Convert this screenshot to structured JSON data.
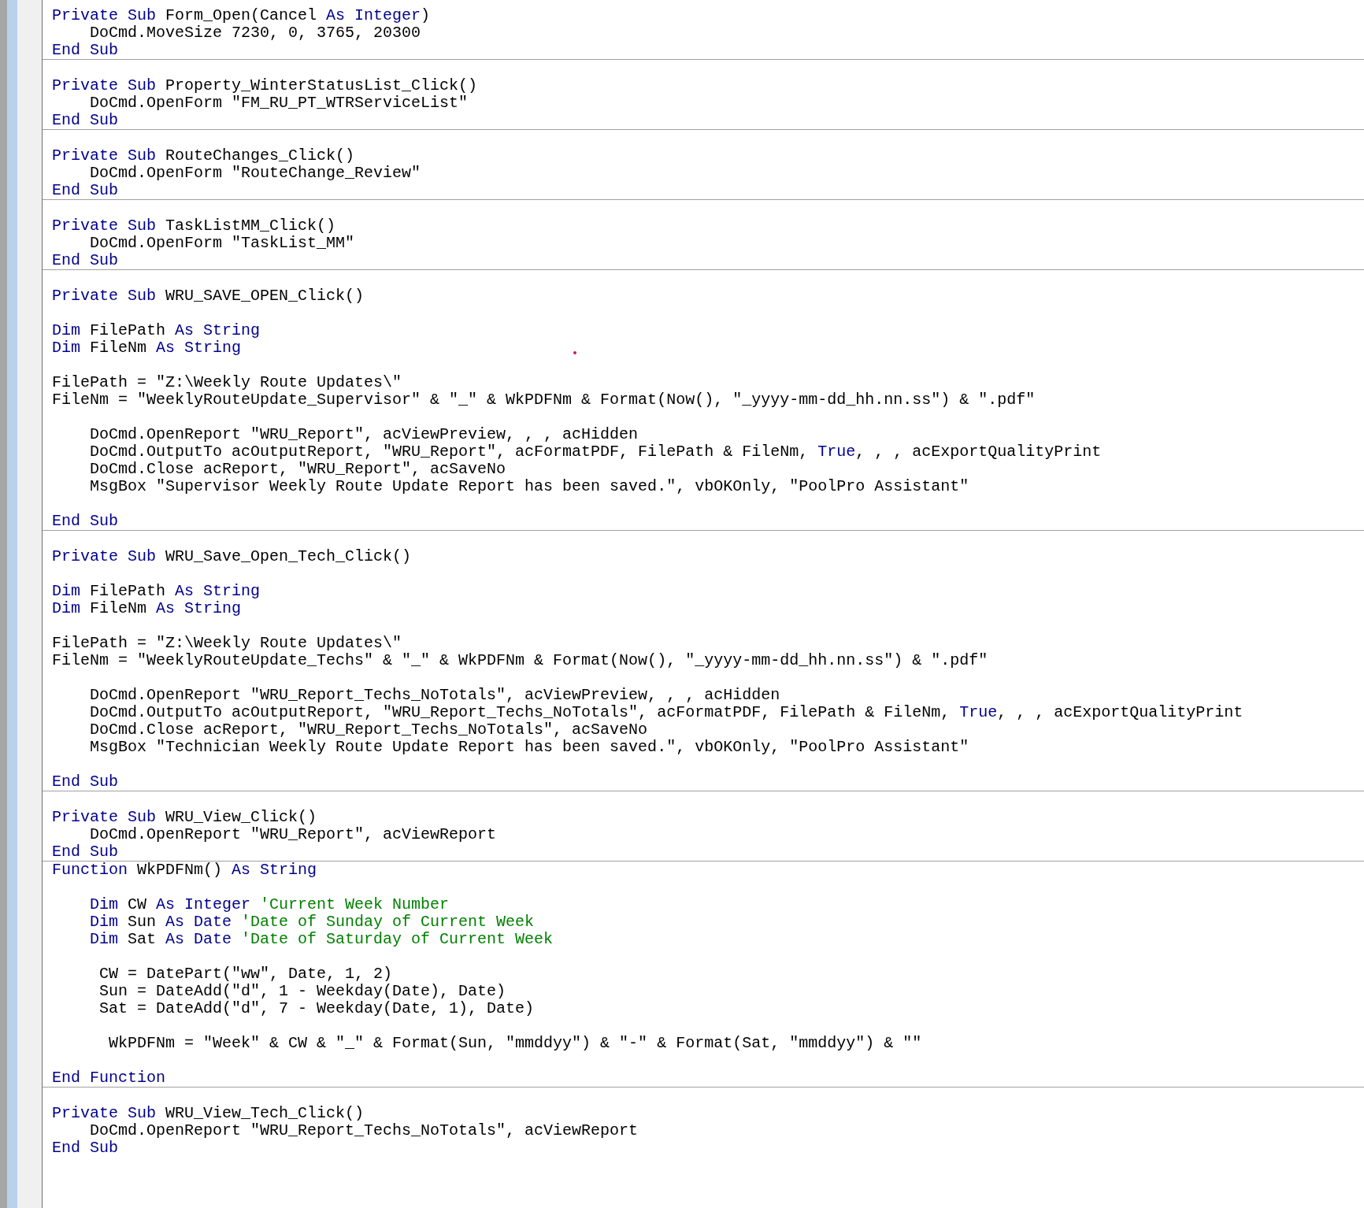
{
  "procedures": [
    {
      "lines": [
        {
          "kind": "code",
          "tokens": [
            {
              "kind": "keyword",
              "text": "Private Sub"
            },
            {
              "kind": "code",
              "text": " Form_Open(Cancel "
            },
            {
              "kind": "keyword",
              "text": "As Integer"
            },
            {
              "kind": "code",
              "text": ")"
            }
          ]
        },
        {
          "kind": "code",
          "tokens": [
            {
              "kind": "code",
              "text": "    DoCmd.MoveSize 7230, 0, 3765, 20300"
            }
          ]
        },
        {
          "kind": "code",
          "tokens": [
            {
              "kind": "keyword",
              "text": "End Sub"
            }
          ]
        }
      ]
    },
    {
      "lines": [
        {
          "kind": "blank"
        },
        {
          "kind": "code",
          "tokens": [
            {
              "kind": "keyword",
              "text": "Private Sub"
            },
            {
              "kind": "code",
              "text": " Property_WinterStatusList_Click()"
            }
          ]
        },
        {
          "kind": "code",
          "tokens": [
            {
              "kind": "code",
              "text": "    DoCmd.OpenForm \"FM_RU_PT_WTRServiceList\""
            }
          ]
        },
        {
          "kind": "code",
          "tokens": [
            {
              "kind": "keyword",
              "text": "End Sub"
            }
          ]
        }
      ]
    },
    {
      "lines": [
        {
          "kind": "blank"
        },
        {
          "kind": "code",
          "tokens": [
            {
              "kind": "keyword",
              "text": "Private Sub"
            },
            {
              "kind": "code",
              "text": " RouteChanges_Click()"
            }
          ]
        },
        {
          "kind": "code",
          "tokens": [
            {
              "kind": "code",
              "text": "    DoCmd.OpenForm \"RouteChange_Review\""
            }
          ]
        },
        {
          "kind": "code",
          "tokens": [
            {
              "kind": "keyword",
              "text": "End Sub"
            }
          ]
        }
      ]
    },
    {
      "lines": [
        {
          "kind": "blank"
        },
        {
          "kind": "code",
          "tokens": [
            {
              "kind": "keyword",
              "text": "Private Sub"
            },
            {
              "kind": "code",
              "text": " TaskListMM_Click()"
            }
          ]
        },
        {
          "kind": "code",
          "tokens": [
            {
              "kind": "code",
              "text": "    DoCmd.OpenForm \"TaskList_MM\""
            }
          ]
        },
        {
          "kind": "code",
          "tokens": [
            {
              "kind": "keyword",
              "text": "End Sub"
            }
          ]
        }
      ]
    },
    {
      "lines": [
        {
          "kind": "blank"
        },
        {
          "kind": "code",
          "tokens": [
            {
              "kind": "keyword",
              "text": "Private Sub"
            },
            {
              "kind": "code",
              "text": " WRU_SAVE_OPEN_Click()"
            }
          ]
        },
        {
          "kind": "blank"
        },
        {
          "kind": "code",
          "tokens": [
            {
              "kind": "keyword",
              "text": "Dim"
            },
            {
              "kind": "code",
              "text": " FilePath "
            },
            {
              "kind": "keyword",
              "text": "As String"
            }
          ]
        },
        {
          "kind": "code",
          "tokens": [
            {
              "kind": "keyword",
              "text": "Dim"
            },
            {
              "kind": "code",
              "text": " FileNm "
            },
            {
              "kind": "keyword",
              "text": "As String"
            }
          ]
        },
        {
          "kind": "blank"
        },
        {
          "kind": "code",
          "tokens": [
            {
              "kind": "code",
              "text": "FilePath = \"Z:\\Weekly Route Updates\\\""
            }
          ]
        },
        {
          "kind": "code",
          "tokens": [
            {
              "kind": "code",
              "text": "FileNm = \"WeeklyRouteUpdate_Supervisor\" & \"_\" & WkPDFNm & Format(Now(), \"_yyyy-mm-dd_hh.nn.ss\") & \".pdf\""
            }
          ]
        },
        {
          "kind": "blank"
        },
        {
          "kind": "code",
          "tokens": [
            {
              "kind": "code",
              "text": "    DoCmd.OpenReport \"WRU_Report\", acViewPreview, , , acHidden"
            }
          ]
        },
        {
          "kind": "code",
          "tokens": [
            {
              "kind": "code",
              "text": "    DoCmd.OutputTo acOutputReport, \"WRU_Report\", acFormatPDF, FilePath & FileNm, "
            },
            {
              "kind": "keyword",
              "text": "True"
            },
            {
              "kind": "code",
              "text": ", , , acExportQualityPrint"
            }
          ]
        },
        {
          "kind": "code",
          "tokens": [
            {
              "kind": "code",
              "text": "    DoCmd.Close acReport, \"WRU_Report\", acSaveNo"
            }
          ]
        },
        {
          "kind": "code",
          "tokens": [
            {
              "kind": "code",
              "text": "    MsgBox \"Supervisor Weekly Route Update Report has been saved.\", vbOKOnly, \"PoolPro Assistant\""
            }
          ]
        },
        {
          "kind": "blank"
        },
        {
          "kind": "code",
          "tokens": [
            {
              "kind": "keyword",
              "text": "End Sub"
            }
          ]
        }
      ]
    },
    {
      "lines": [
        {
          "kind": "blank"
        },
        {
          "kind": "code",
          "tokens": [
            {
              "kind": "keyword",
              "text": "Private Sub"
            },
            {
              "kind": "code",
              "text": " WRU_Save_Open_Tech_Click()"
            }
          ]
        },
        {
          "kind": "blank"
        },
        {
          "kind": "code",
          "tokens": [
            {
              "kind": "keyword",
              "text": "Dim"
            },
            {
              "kind": "code",
              "text": " FilePath "
            },
            {
              "kind": "keyword",
              "text": "As String"
            }
          ]
        },
        {
          "kind": "code",
          "tokens": [
            {
              "kind": "keyword",
              "text": "Dim"
            },
            {
              "kind": "code",
              "text": " FileNm "
            },
            {
              "kind": "keyword",
              "text": "As String"
            }
          ]
        },
        {
          "kind": "blank"
        },
        {
          "kind": "code",
          "tokens": [
            {
              "kind": "code",
              "text": "FilePath = \"Z:\\Weekly Route Updates\\\""
            }
          ]
        },
        {
          "kind": "code",
          "tokens": [
            {
              "kind": "code",
              "text": "FileNm = \"WeeklyRouteUpdate_Techs\" & \"_\" & WkPDFNm & Format(Now(), \"_yyyy-mm-dd_hh.nn.ss\") & \".pdf\""
            }
          ]
        },
        {
          "kind": "blank"
        },
        {
          "kind": "code",
          "tokens": [
            {
              "kind": "code",
              "text": "    DoCmd.OpenReport \"WRU_Report_Techs_NoTotals\", acViewPreview, , , acHidden"
            }
          ]
        },
        {
          "kind": "code",
          "tokens": [
            {
              "kind": "code",
              "text": "    DoCmd.OutputTo acOutputReport, \"WRU_Report_Techs_NoTotals\", acFormatPDF, FilePath & FileNm, "
            },
            {
              "kind": "keyword",
              "text": "True"
            },
            {
              "kind": "code",
              "text": ", , , acExportQualityPrint"
            }
          ]
        },
        {
          "kind": "code",
          "tokens": [
            {
              "kind": "code",
              "text": "    DoCmd.Close acReport, \"WRU_Report_Techs_NoTotals\", acSaveNo"
            }
          ]
        },
        {
          "kind": "code",
          "tokens": [
            {
              "kind": "code",
              "text": "    MsgBox \"Technician Weekly Route Update Report has been saved.\", vbOKOnly, \"PoolPro Assistant\""
            }
          ]
        },
        {
          "kind": "blank"
        },
        {
          "kind": "code",
          "tokens": [
            {
              "kind": "keyword",
              "text": "End Sub"
            }
          ]
        }
      ]
    },
    {
      "lines": [
        {
          "kind": "blank"
        },
        {
          "kind": "code",
          "tokens": [
            {
              "kind": "keyword",
              "text": "Private Sub"
            },
            {
              "kind": "code",
              "text": " WRU_View_Click()"
            }
          ]
        },
        {
          "kind": "code",
          "tokens": [
            {
              "kind": "code",
              "text": "    DoCmd.OpenReport \"WRU_Report\", acViewReport"
            }
          ]
        },
        {
          "kind": "code",
          "tokens": [
            {
              "kind": "keyword",
              "text": "End Sub"
            }
          ]
        }
      ]
    },
    {
      "lines": [
        {
          "kind": "code",
          "tokens": [
            {
              "kind": "keyword",
              "text": "Function"
            },
            {
              "kind": "code",
              "text": " WkPDFNm() "
            },
            {
              "kind": "keyword",
              "text": "As String"
            }
          ]
        },
        {
          "kind": "blank"
        },
        {
          "kind": "code",
          "tokens": [
            {
              "kind": "keyword",
              "text": "    Dim"
            },
            {
              "kind": "code",
              "text": " CW "
            },
            {
              "kind": "keyword",
              "text": "As Integer"
            },
            {
              "kind": "comment",
              "text": " 'Current Week Number"
            }
          ]
        },
        {
          "kind": "code",
          "tokens": [
            {
              "kind": "keyword",
              "text": "    Dim"
            },
            {
              "kind": "code",
              "text": " Sun "
            },
            {
              "kind": "keyword",
              "text": "As Date"
            },
            {
              "kind": "comment",
              "text": " 'Date of Sunday of Current Week"
            }
          ]
        },
        {
          "kind": "code",
          "tokens": [
            {
              "kind": "keyword",
              "text": "    Dim"
            },
            {
              "kind": "code",
              "text": " Sat "
            },
            {
              "kind": "keyword",
              "text": "As Date"
            },
            {
              "kind": "comment",
              "text": " 'Date of Saturday of Current Week"
            }
          ]
        },
        {
          "kind": "blank"
        },
        {
          "kind": "code",
          "tokens": [
            {
              "kind": "code",
              "text": "     CW = DatePart(\"ww\", Date, 1, 2)"
            }
          ]
        },
        {
          "kind": "code",
          "tokens": [
            {
              "kind": "code",
              "text": "     Sun = DateAdd(\"d\", 1 - Weekday(Date), Date)"
            }
          ]
        },
        {
          "kind": "code",
          "tokens": [
            {
              "kind": "code",
              "text": "     Sat = DateAdd(\"d\", 7 - Weekday(Date, 1), Date)"
            }
          ]
        },
        {
          "kind": "blank"
        },
        {
          "kind": "code",
          "tokens": [
            {
              "kind": "code",
              "text": "      WkPDFNm = \"Week\" & CW & \"_\" & Format(Sun, \"mmddyy\") & \"-\" & Format(Sat, \"mmddyy\") & \"\""
            }
          ]
        },
        {
          "kind": "blank"
        },
        {
          "kind": "code",
          "tokens": [
            {
              "kind": "keyword",
              "text": "End Function"
            }
          ]
        }
      ]
    },
    {
      "lines": [
        {
          "kind": "blank"
        },
        {
          "kind": "code",
          "tokens": [
            {
              "kind": "keyword",
              "text": "Private Sub"
            },
            {
              "kind": "code",
              "text": " WRU_View_Tech_Click()"
            }
          ]
        },
        {
          "kind": "code",
          "tokens": [
            {
              "kind": "code",
              "text": "    DoCmd.OpenReport \"WRU_Report_Techs_NoTotals\", acViewReport"
            }
          ]
        },
        {
          "kind": "code",
          "tokens": [
            {
              "kind": "keyword",
              "text": "End Sub"
            }
          ]
        }
      ]
    }
  ]
}
